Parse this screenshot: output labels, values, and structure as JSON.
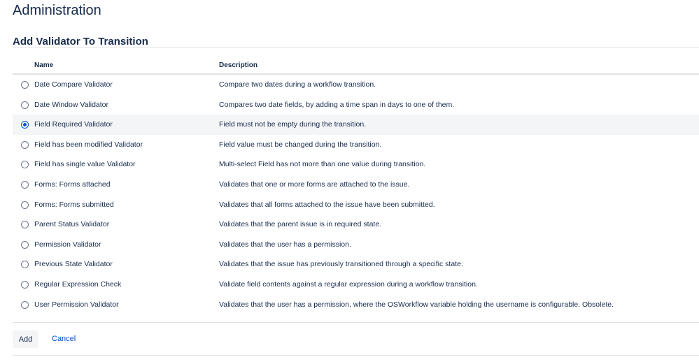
{
  "header": {
    "title": "Administration"
  },
  "section": {
    "title": "Add Validator To Transition"
  },
  "table": {
    "columns": {
      "name": "Name",
      "description": "Description"
    },
    "rows": [
      {
        "name": "Date Compare Validator",
        "description": "Compare two dates during a workflow transition.",
        "selected": false
      },
      {
        "name": "Date Window Validator",
        "description": "Compares two date fields, by adding a time span in days to one of them.",
        "selected": false
      },
      {
        "name": "Field Required Validator",
        "description": "Field must not be empty during the transition.",
        "selected": true
      },
      {
        "name": "Field has been modified Validator",
        "description": "Field value must be changed during the transition.",
        "selected": false
      },
      {
        "name": "Field has single value Validator",
        "description": "Multi-select Field has not more than one value during transition.",
        "selected": false
      },
      {
        "name": "Forms: Forms attached",
        "description": "Validates that one or more forms are attached to the issue.",
        "selected": false
      },
      {
        "name": "Forms: Forms submitted",
        "description": "Validates that all forms attached to the issue have been submitted.",
        "selected": false
      },
      {
        "name": "Parent Status Validator",
        "description": "Validates that the parent issue is in required state.",
        "selected": false
      },
      {
        "name": "Permission Validator",
        "description": "Validates that the user has a permission.",
        "selected": false
      },
      {
        "name": "Previous State Validator",
        "description": "Validates that the issue has previously transitioned through a specific state.",
        "selected": false
      },
      {
        "name": "Regular Expression Check",
        "description": "Validate field contents against a regular expression during a workflow transition.",
        "selected": false
      },
      {
        "name": "User Permission Validator",
        "description": "Validates that the user has a permission, where the OSWorkflow variable holding the username is configurable. Obsolete.",
        "selected": false
      }
    ]
  },
  "actions": {
    "add_label": "Add",
    "cancel_label": "Cancel"
  },
  "colors": {
    "accent": "#0052cc",
    "text": "#172b4d",
    "selected_row": "#f4f5f7",
    "border": "#dfe1e6"
  }
}
